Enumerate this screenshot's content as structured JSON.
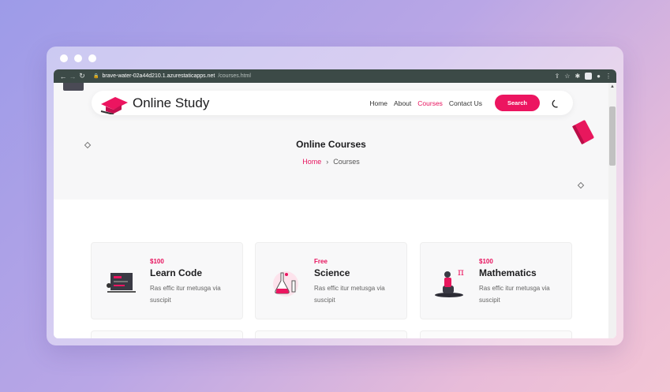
{
  "browser": {
    "url_host": "brave-water-02a44d210.1.azurestaticapps.net",
    "url_path": "/courses.html"
  },
  "site": {
    "brand": "Online Study",
    "nav": [
      "Home",
      "About",
      "Courses",
      "Contact Us"
    ],
    "active_nav": "Courses",
    "search_label": "Search"
  },
  "hero": {
    "title": "Online Courses",
    "breadcrumb_home": "Home",
    "breadcrumb_separator": "›",
    "breadcrumb_current": "Courses"
  },
  "courses": [
    {
      "price": "$100",
      "title": "Learn Code",
      "description": "Ras effic itur metusga via suscipit",
      "icon": "code-board-illustration"
    },
    {
      "price": "Free",
      "title": "Science",
      "description": "Ras effic itur metusga via suscipit",
      "icon": "science-flask-illustration"
    },
    {
      "price": "$100",
      "title": "Mathematics",
      "description": "Ras effic itur metusga via suscipit",
      "icon": "math-pi-illustration"
    }
  ],
  "colors": {
    "accent": "#ec1560",
    "chrome": "#3c4a47",
    "hero_bg": "#f7f7f8"
  }
}
